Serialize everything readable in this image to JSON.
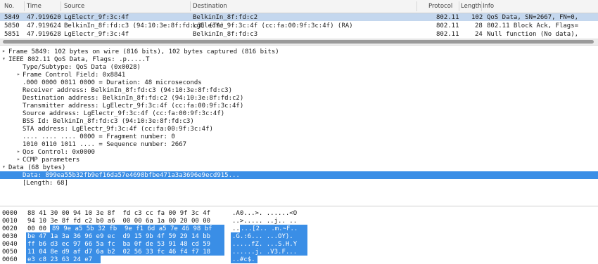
{
  "columns": {
    "no": "No.",
    "time": "Time",
    "source": "Source",
    "destination": "Destination",
    "protocol": "Protocol",
    "length": "Length",
    "info": "Info"
  },
  "packets": [
    {
      "no": "5849",
      "time": "47.919620",
      "source": "LgElectr_9f:3c:4f",
      "destination": "BelkinIn_8f:fd:c2",
      "protocol": "802.11",
      "length": "102",
      "info": "QoS Data, SN=2667, FN=0,"
    },
    {
      "no": "5850",
      "time": "47.919624",
      "source": "BelkinIn_8f:fd:c3 (94:10:3e:8f:fd:c3) (TA)",
      "destination": "LgElectr_9f:3c:4f (cc:fa:00:9f:3c:4f) (RA)",
      "protocol": "802.11",
      "length": "28",
      "info": "802.11 Block Ack, Flags="
    },
    {
      "no": "5851",
      "time": "47.919628",
      "source": "LgElectr_9f:3c:4f",
      "destination": "BelkinIn_8f:fd:c3",
      "protocol": "802.11",
      "length": "24",
      "info": "Null function (No data),"
    }
  ],
  "details": [
    {
      "text": "Frame 5849: 102 bytes on wire (816 bits), 102 bytes captured (816 bits)",
      "arrow": "▸",
      "indent": 0
    },
    {
      "text": "IEEE 802.11 QoS Data, Flags: .p.....T",
      "arrow": "▾",
      "indent": 0
    },
    {
      "text": "Type/Subtype: QoS Data (0x0028)",
      "arrow": "",
      "indent": 1
    },
    {
      "text": "Frame Control Field: 0x8841",
      "arrow": "▸",
      "indent": 1
    },
    {
      "text": ".000 0000 0011 0000 = Duration: 48 microseconds",
      "arrow": "",
      "indent": 1
    },
    {
      "text": "Receiver address: BelkinIn_8f:fd:c3 (94:10:3e:8f:fd:c3)",
      "arrow": "",
      "indent": 1
    },
    {
      "text": "Destination address: BelkinIn_8f:fd:c2 (94:10:3e:8f:fd:c2)",
      "arrow": "",
      "indent": 1
    },
    {
      "text": "Transmitter address: LgElectr_9f:3c:4f (cc:fa:00:9f:3c:4f)",
      "arrow": "",
      "indent": 1
    },
    {
      "text": "Source address: LgElectr_9f:3c:4f (cc:fa:00:9f:3c:4f)",
      "arrow": "",
      "indent": 1
    },
    {
      "text": "BSS Id: BelkinIn_8f:fd:c3 (94:10:3e:8f:fd:c3)",
      "arrow": "",
      "indent": 1
    },
    {
      "text": "STA address: LgElectr_9f:3c:4f (cc:fa:00:9f:3c:4f)",
      "arrow": "",
      "indent": 1
    },
    {
      "text": ".... .... .... 0000 = Fragment number: 0",
      "arrow": "",
      "indent": 1
    },
    {
      "text": "1010 0110 1011 .... = Sequence number: 2667",
      "arrow": "",
      "indent": 1
    },
    {
      "text": "Qos Control: 0x0000",
      "arrow": "▸",
      "indent": 1
    },
    {
      "text": "CCMP parameters",
      "arrow": "▸",
      "indent": 1
    },
    {
      "text": "Data (68 bytes)",
      "arrow": "▾",
      "indent": 0
    },
    {
      "text": "Data: 899ea55b32fb9ef16da57e4698bfbe471a3a3696e9ecd915...",
      "arrow": "",
      "indent": 1,
      "highlight": true
    },
    {
      "text": "[Length: 68]",
      "arrow": "",
      "indent": 1
    }
  ],
  "bytes": [
    {
      "offset": "0000",
      "hex_plain": "88 41 30 00 94 10 3e 8f  fd c3 cc fa 00 9f 3c 4f",
      "hex_hl": "",
      "ascii_plain": ".A0...>. ......<O",
      "ascii_hl": ""
    },
    {
      "offset": "0010",
      "hex_plain": "94 10 3e 8f fd c2 b0 a6  00 00 6a 1a 00 20 00 00",
      "hex_hl": "",
      "ascii_plain": "..>..... ..j.. ..",
      "ascii_hl": ""
    },
    {
      "offset": "0020",
      "hex_plain": "00 00 ",
      "hex_hl": "89 9e a5 5b 32 fb  9e f1 6d a5 7e 46 98 bf",
      "ascii_plain": "..",
      "ascii_hl": "...[2.. .m.~F.."
    },
    {
      "offset": "0030",
      "hex_plain": "",
      "hex_hl": "be 47 1a 3a 36 96 e9 ec  d9 15 9b 4f 59 29 14 bb",
      "ascii_plain": "",
      "ascii_hl": ".G.:6... ...OY)."
    },
    {
      "offset": "0040",
      "hex_plain": "",
      "hex_hl": "ff b6 d3 ec 97 66 5a fc  ba 0f de 53 91 48 cd 59",
      "ascii_plain": "",
      "ascii_hl": ".....fZ. ...S.H.Y"
    },
    {
      "offset": "0050",
      "hex_plain": "",
      "hex_hl": "11 04 8e d9 af d7 6a b2  02 56 33 fc 46 f4 f7 18",
      "ascii_plain": "",
      "ascii_hl": "......j. .V3.F..."
    },
    {
      "offset": "0060",
      "hex_plain": "",
      "hex_hl": "e3 c8 23 63 24 e7",
      "ascii_plain": "",
      "ascii_hl": "..#c$."
    }
  ]
}
